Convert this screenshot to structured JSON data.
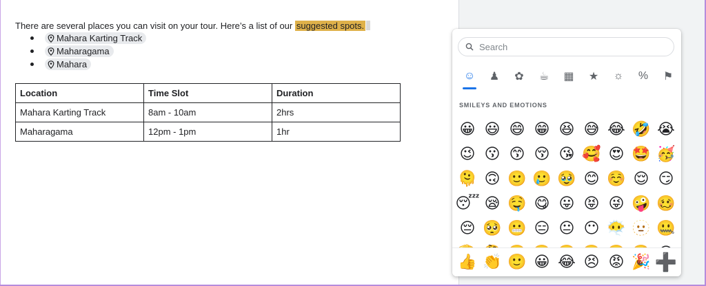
{
  "document": {
    "intro_text": "There are several places you can visit on your tour. Here’s a list of our ",
    "highlight_text": "suggested spots.",
    "places": [
      {
        "label": "Mahara Karting Track"
      },
      {
        "label": "Maharagama"
      },
      {
        "label": "Mahara"
      }
    ],
    "table": {
      "headers": [
        "Location",
        "Time Slot",
        "Duration"
      ],
      "rows": [
        [
          "Mahara Karting Track",
          "8am - 10am",
          "2hrs"
        ],
        [
          "Maharagama",
          "12pm - 1pm",
          "1hr"
        ]
      ]
    }
  },
  "emoji_picker": {
    "search_placeholder": "Search",
    "categories": [
      {
        "name": "smileys",
        "glyph": "☺",
        "icon": "smiley-icon",
        "active": true
      },
      {
        "name": "people",
        "glyph": "♟",
        "icon": "person-icon"
      },
      {
        "name": "animals",
        "glyph": "✿",
        "icon": "animals-nature-icon"
      },
      {
        "name": "food",
        "glyph": "☕",
        "icon": "food-drink-icon"
      },
      {
        "name": "travel",
        "glyph": "▦",
        "icon": "travel-places-icon"
      },
      {
        "name": "activities",
        "glyph": "★",
        "icon": "trophy-icon"
      },
      {
        "name": "objects",
        "glyph": "☼",
        "icon": "lightbulb-icon"
      },
      {
        "name": "symbols",
        "glyph": "%",
        "icon": "symbols-icon"
      },
      {
        "name": "flags",
        "glyph": "⚑",
        "icon": "flag-icon"
      }
    ],
    "section_title": "SMILEYS AND EMOTIONS",
    "emojis": [
      "😀",
      "😃",
      "😄",
      "😁",
      "😆",
      "😅",
      "😂",
      "🤣",
      "😭",
      "😉",
      "😗",
      "😙",
      "😚",
      "😘",
      "🥰",
      "😍",
      "🤩",
      "🥳",
      "🫠",
      "🙃",
      "🙂",
      "🥲",
      "🥹",
      "😊",
      "☺️",
      "😌",
      "😏",
      "😴",
      "😪",
      "🤤",
      "😋",
      "😛",
      "😝",
      "😜",
      "🤪",
      "🥴",
      "😔",
      "🥺",
      "😬",
      "😑",
      "😐",
      "😶",
      "😶‍🌫️",
      "🫥",
      "🤐",
      "🫡",
      "🤔",
      "🤫",
      "🫢",
      "🤭",
      "🥱",
      "🤗",
      "🫣",
      "😱"
    ],
    "recent_emojis": [
      "👍",
      "👏",
      "🙂",
      "😀",
      "😂",
      "😣",
      "😡",
      "🎉"
    ],
    "add_glyph": "➕"
  }
}
